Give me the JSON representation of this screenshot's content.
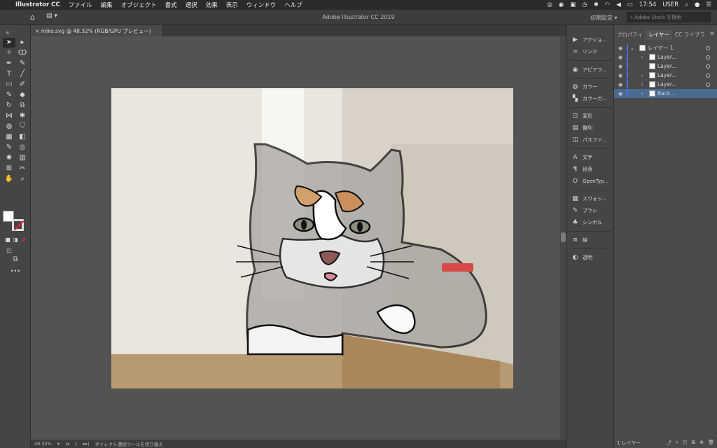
{
  "menubar": {
    "app_name": "Illustrator CC",
    "items": [
      "ファイル",
      "編集",
      "オブジェクト",
      "書式",
      "選択",
      "効果",
      "表示",
      "ウィンドウ",
      "ヘルプ"
    ],
    "clock": "17:54",
    "user": "USER"
  },
  "titlebar": {
    "title": "Adobe Illustrator CC 2019",
    "preset": "初期設定",
    "stock_placeholder": "Adobe Stock を検索"
  },
  "document": {
    "tab_label": "miko.svg @ 48.32% (RGB/GPU プレビュー)"
  },
  "statusbar": {
    "zoom": "48.32%",
    "artboard": "1",
    "tool_hint": "ダイレクト選択ツールを切り換え"
  },
  "dock": {
    "items": [
      "アクショ...",
      "リンク",
      "アピアラ...",
      "カラー",
      "カラーガ...",
      "変形",
      "整列",
      "パスファ...",
      "文字",
      "段落",
      "OpenTyp...",
      "スウォッ...",
      "ブラシ",
      "シンボル",
      "線",
      "透明"
    ]
  },
  "panel": {
    "tabs": [
      "プロパティ",
      "レイヤー",
      "CC ライブラ"
    ],
    "layers": [
      {
        "name": "レイヤー 1"
      },
      {
        "name": "Layer..."
      },
      {
        "name": "Layer..."
      },
      {
        "name": "Layer..."
      },
      {
        "name": "Layer..."
      },
      {
        "name": "Back..."
      }
    ],
    "footer": "1 レイヤー"
  }
}
